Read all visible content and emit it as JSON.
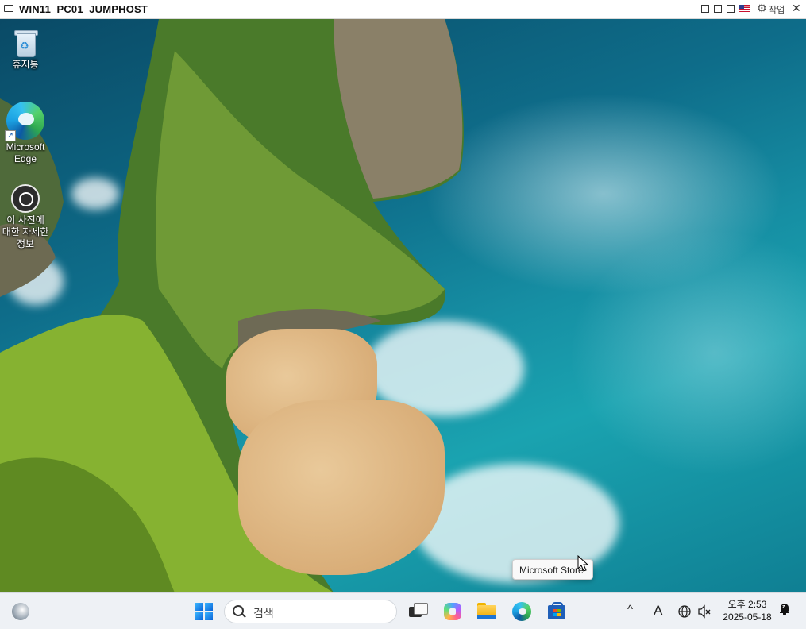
{
  "window": {
    "title": "WIN11_PC01_JUMPHOST",
    "work_label": "작업",
    "close_glyph": "✕",
    "settings_glyph": "⚙"
  },
  "desktop": {
    "icons": [
      {
        "label": "휴지통",
        "icon": "recycle-bin-icon"
      },
      {
        "label": "Microsoft\nEdge",
        "icon": "edge-icon"
      },
      {
        "label": "이 사진에\n대한 자세한\n정보",
        "icon": "camera-info-icon"
      }
    ],
    "tooltip": "Microsoft Store"
  },
  "taskbar": {
    "search_placeholder": "검색",
    "apps": [
      "widgets-icon",
      "start-icon",
      "task-view-icon",
      "copilot-icon",
      "file-explorer-icon",
      "edge-icon",
      "microsoft-store-icon"
    ],
    "tray": {
      "chevron": "^",
      "ime": "A",
      "time": "오후 2:53",
      "date": "2025-05-18"
    }
  }
}
